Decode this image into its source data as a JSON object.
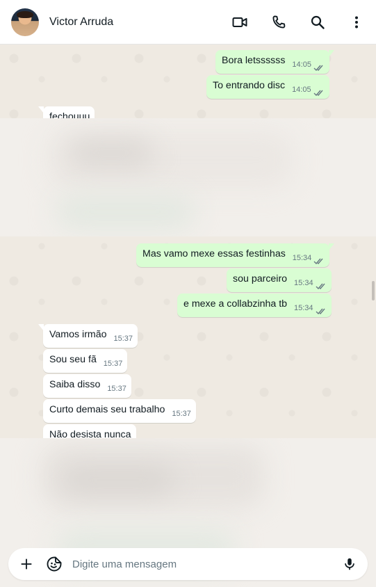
{
  "header": {
    "contact_name": "Victor Arruda"
  },
  "icons": {
    "video": "video-call-icon",
    "phone": "voice-call-icon",
    "search": "search-icon",
    "menu": "more-options-icon",
    "attach": "plus-icon",
    "sticker": "sticker-icon",
    "mic": "microphone-icon"
  },
  "colors": {
    "outgoing_bubble": "#d9fdd3",
    "incoming_bubble": "#ffffff",
    "background": "#efeae2",
    "timestamp": "#667781"
  },
  "messages": [
    {
      "dir": "out",
      "text": "Bora letssssss",
      "time": "14:05"
    },
    {
      "dir": "out",
      "text": "To entrando disc",
      "time": "14:05"
    },
    {
      "dir": "in",
      "text": "fechouuu",
      "time": ""
    },
    {
      "dir": "out",
      "text": "Mas vamo mexe essas festinhas",
      "time": "15:34"
    },
    {
      "dir": "out",
      "text": "sou parceiro",
      "time": "15:34"
    },
    {
      "dir": "out",
      "text": "e mexe a collabzinha tb",
      "time": "15:34"
    },
    {
      "dir": "in",
      "text": "Vamos irmão",
      "time": "15:37"
    },
    {
      "dir": "in",
      "text": "Sou seu fã",
      "time": "15:37"
    },
    {
      "dir": "in",
      "text": "Saiba disso",
      "time": "15:37"
    },
    {
      "dir": "in",
      "text": "Curto demais seu trabalho",
      "time": "15:37"
    },
    {
      "dir": "in",
      "text": "Não desista nunca",
      "time": ""
    }
  ],
  "composer": {
    "placeholder": "Digite uma mensagem"
  }
}
